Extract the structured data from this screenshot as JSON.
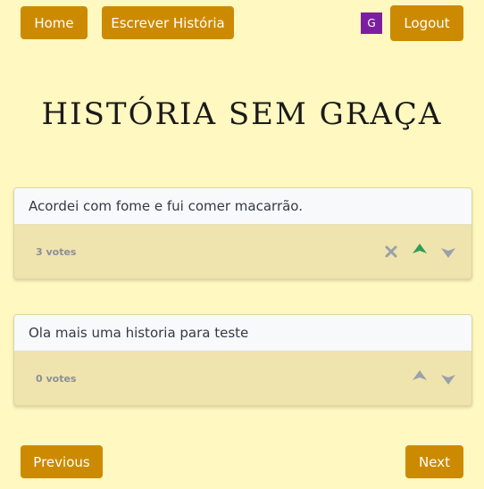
{
  "nav": {
    "home_label": "Home",
    "write_label": "Escrever História",
    "avatar_letter": "G",
    "logout_label": "Logout"
  },
  "page": {
    "title": "HISTÓRIA SEM GRAÇA"
  },
  "stories": [
    {
      "text": "Acordei com fome e fui comer macarrão.",
      "votes_label": "3 votes",
      "actions": [
        "close-icon",
        "upvote-icon",
        "downvote-icon"
      ],
      "upvoted": true
    },
    {
      "text": "Ola mais uma historia para teste",
      "votes_label": "0 votes",
      "actions": [
        "upvote-icon",
        "downvote-icon"
      ],
      "upvoted": false
    }
  ],
  "pagination": {
    "previous_label": "Previous",
    "next_label": "Next"
  },
  "colors": {
    "background": "#fff8c0",
    "button": "#cc8a00",
    "avatar": "#7b1fa2",
    "upvote_active": "#2e9e55",
    "icon_inactive": "#9aa1aa"
  }
}
